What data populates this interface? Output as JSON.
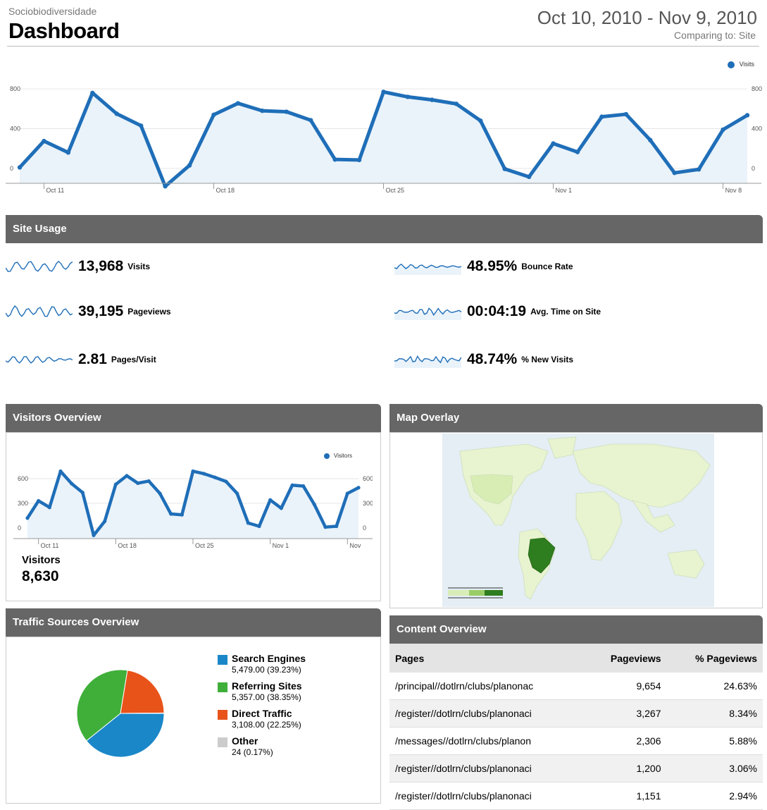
{
  "header": {
    "site_name": "Sociobiodiversidade",
    "title": "Dashboard",
    "date_range": "Oct 10, 2010 - Nov 9, 2010",
    "comparing": "Comparing to: Site"
  },
  "colors": {
    "series": "#1F6EB8",
    "bar": "#666666",
    "fill": "#EAF3FA"
  },
  "chart_data": [
    {
      "type": "line",
      "name": "Main Visits chart",
      "legend": "Visits",
      "x_ticks": [
        "Oct 11",
        "Oct 18",
        "Oct 25",
        "Nov 1",
        "Nov 8"
      ],
      "y_ticks": [
        0,
        400,
        800
      ],
      "ylim": [
        -150,
        950
      ],
      "series": [
        {
          "name": "Visits",
          "values": [
            10,
            275,
            160,
            760,
            550,
            430,
            -180,
            30,
            540,
            655,
            580,
            570,
            485,
            90,
            85,
            770,
            720,
            690,
            650,
            480,
            -5,
            -85,
            250,
            165,
            520,
            545,
            285,
            -45,
            -10,
            390,
            535
          ]
        }
      ]
    },
    {
      "type": "line",
      "name": "Visitors chart",
      "legend": "Visitors",
      "x_ticks": [
        "Oct 11",
        "Oct 18",
        "Oct 25",
        "Nov 1",
        "Nov"
      ],
      "y_ticks": [
        0,
        300,
        600
      ],
      "ylim": [
        -130,
        780
      ],
      "series": [
        {
          "name": "Visitors",
          "values": [
            120,
            330,
            250,
            690,
            540,
            430,
            -90,
            80,
            530,
            635,
            545,
            570,
            420,
            170,
            160,
            690,
            660,
            615,
            565,
            420,
            60,
            20,
            340,
            240,
            520,
            510,
            285,
            10,
            20,
            420,
            490
          ]
        }
      ]
    },
    {
      "type": "pie",
      "name": "Traffic sources",
      "categories": [
        "Search Engines",
        "Referring Sites",
        "Direct Traffic",
        "Other"
      ],
      "values": [
        5479,
        5357,
        3108,
        24
      ],
      "colors": [
        "#1A87C9",
        "#3FAF3A",
        "#E8531A",
        "#CCCCCC"
      ]
    }
  ],
  "site_usage": {
    "title": "Site Usage",
    "metrics": [
      {
        "value": "13,968",
        "label": "Visits"
      },
      {
        "value": "39,195",
        "label": "Pageviews"
      },
      {
        "value": "2.81",
        "label": "Pages/Visit"
      },
      {
        "value": "48.95%",
        "label": "Bounce Rate"
      },
      {
        "value": "00:04:19",
        "label": "Avg. Time on Site"
      },
      {
        "value": "48.74%",
        "label": "% New Visits"
      }
    ]
  },
  "visitors_overview": {
    "title": "Visitors Overview",
    "label": "Visitors",
    "value": "8,630"
  },
  "map_overlay": {
    "title": "Map Overlay",
    "highlight": "Brazil"
  },
  "traffic_sources": {
    "title": "Traffic Sources Overview",
    "items": [
      {
        "name": "Search Engines",
        "value": "5,479.00 (39.23%)"
      },
      {
        "name": "Referring Sites",
        "value": "5,357.00 (38.35%)"
      },
      {
        "name": "Direct Traffic",
        "value": "3,108.00 (22.25%)"
      },
      {
        "name": "Other",
        "value": "24 (0.17%)"
      }
    ]
  },
  "content_overview": {
    "title": "Content Overview",
    "headers": [
      "Pages",
      "Pageviews",
      "% Pageviews"
    ],
    "rows": [
      [
        "/principal//dotlrn/clubs/planonac",
        "9,654",
        "24.63%"
      ],
      [
        "/register//dotlrn/clubs/planonaci",
        "3,267",
        "8.34%"
      ],
      [
        "/messages//dotlrn/clubs/planon",
        "2,306",
        "5.88%"
      ],
      [
        "/register//dotlrn/clubs/planonaci",
        "1,200",
        "3.06%"
      ],
      [
        "/register//dotlrn/clubs/planonaci",
        "1,151",
        "2.94%"
      ]
    ]
  }
}
